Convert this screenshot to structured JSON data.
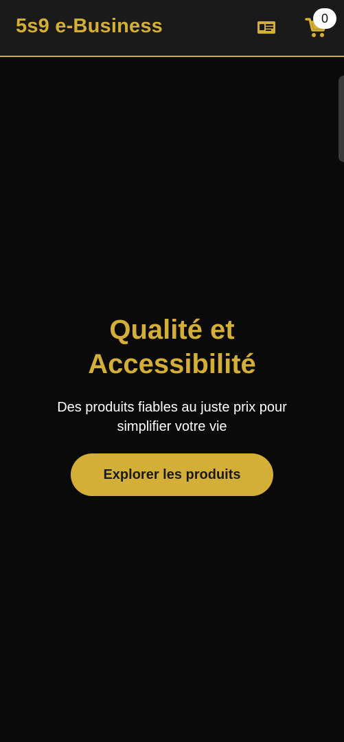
{
  "header": {
    "brand": "5s9 e-Business",
    "id_card_icon": "id-card-icon",
    "cart_icon": "cart-icon",
    "cart_count": "0"
  },
  "hero": {
    "title_line1": "Qualité et",
    "title_line2": "Accessibilité",
    "subtitle_line1": "Des produits fiables au juste prix pour",
    "subtitle_line2": "simplifier votre vie",
    "cta_label": "Explorer les produits"
  },
  "colors": {
    "accent": "#d4af37",
    "background": "#0a0a0a",
    "header_bg": "#1a1a1a",
    "text_light": "#ffffff"
  }
}
